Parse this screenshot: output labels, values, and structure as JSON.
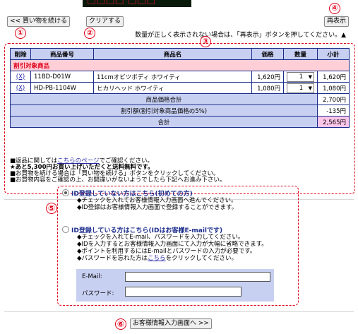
{
  "banner_text": "□□□□ □□□",
  "toolbar": {
    "continue_label": "<< 買い物を続ける",
    "clear_label": "クリアする",
    "refresh_label": "再表示"
  },
  "markers": [
    "①",
    "②",
    "③",
    "④",
    "⑤",
    "⑥"
  ],
  "notice": "数量が正しく表示されない場合は、「再表示」ボタンを押してください。▲",
  "cart": {
    "headers": [
      "削除",
      "商品番号",
      "商品名",
      "価格",
      "数量",
      "小計"
    ],
    "section_label": "割引対象商品",
    "rows": [
      {
        "delete": "(X)",
        "code": "11BD-D01W",
        "name": "11cmオビツボディ ホワイティ",
        "price": "1,620円",
        "qty": "1",
        "subtotal": "1,620円"
      },
      {
        "delete": "(X)",
        "code": "HD-PB-1104W",
        "name": "ヒカリヘッド ホワイティ",
        "price": "1,080円",
        "qty": "1",
        "subtotal": "1,080円"
      }
    ],
    "summary": [
      {
        "label": "商品価格合計",
        "value": "2,700円"
      },
      {
        "label": "割引額(割引対象商品価格の5%)",
        "value": "-135円"
      },
      {
        "label": "合計",
        "value": "2,565円"
      }
    ]
  },
  "notes": {
    "line1_pre": "■返品に関しては",
    "line1_link": "こちらのページ",
    "line1_post": "でご確認ください。",
    "line2": "★あと5,300円お買い上げいただくと送料無料です。",
    "line3": "■お買物を続ける場合は「買い物を続ける」ボタンをクリックしてください。",
    "line4": "■お買物内容をご確認の上、お間違いがないようでしたら下記へお進み下さい。"
  },
  "option_new": {
    "title": "ID登録していない方はこちら(初めての方)",
    "line1": "◆チェックを入れてお客様情報入力画面へ進んでください。",
    "line2": "◆ID登録はお客様情報入力画面で登録することができます。"
  },
  "option_member": {
    "title": "ID登録している方はこちら(IDはお客様E-mailです)",
    "line1": "◆チェックを入れてE-mail、パスワードを入力してください。",
    "line2": "◆IDを入力するとお客様情報入力画面にて入力が大幅に省略できます。",
    "line3": "◆ポイントを利用するにはE-mailとパスワードの入力が必要です。",
    "line4_pre": "◆パスワードを忘れた方は",
    "line4_link": "こちら",
    "line4_post": "をクリックしてください。",
    "email_label": "E-Mail:",
    "password_label": "パスワード:",
    "email_value": "",
    "password_value": ""
  },
  "next_button_label": "お客様情報入力画面へ >>",
  "colors": {
    "accent_red": "#e0001a",
    "table_header": "#c8d0f2",
    "sale_row": "#ffcfd7",
    "total_cell": "#ffc6ea",
    "border_blue": "#1c2d8c"
  }
}
